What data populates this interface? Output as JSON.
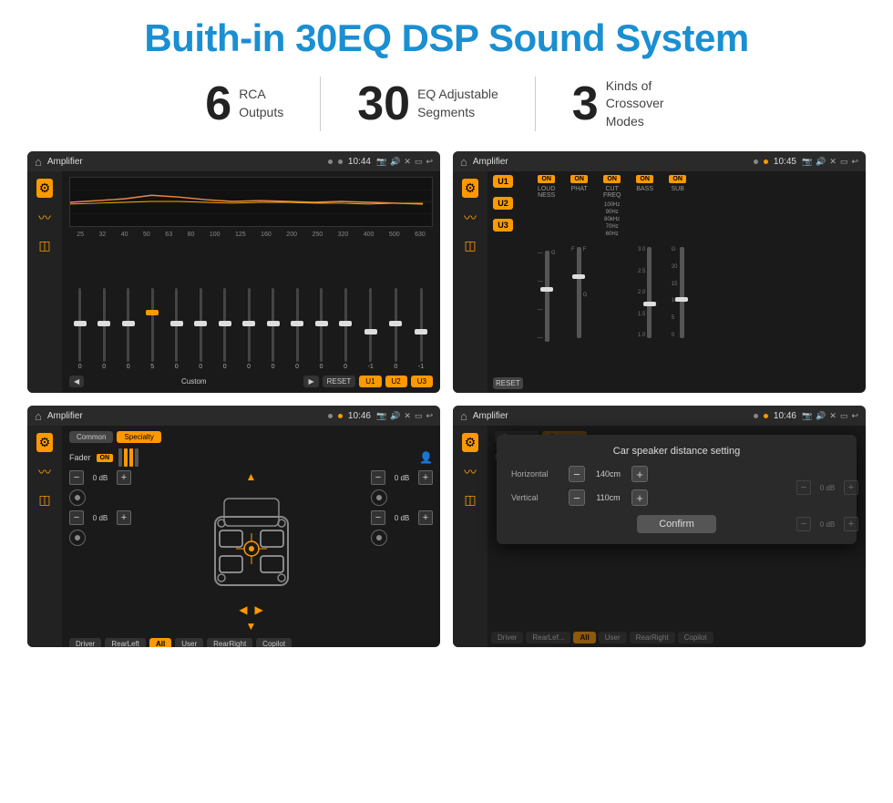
{
  "page": {
    "background": "#ffffff"
  },
  "header": {
    "title": "Buith-in 30EQ DSP Sound System"
  },
  "stats": {
    "item1": {
      "number": "6",
      "label": "RCA\nOutputs"
    },
    "item2": {
      "number": "30",
      "label": "EQ Adjustable\nSegments"
    },
    "item3": {
      "number": "3",
      "label": "Kinds of\nCrossover Modes"
    }
  },
  "screens": {
    "screen1": {
      "status_title": "Amplifier",
      "time": "10:44",
      "type": "eq",
      "freqs": [
        "25",
        "32",
        "40",
        "50",
        "63",
        "80",
        "100",
        "125",
        "160",
        "200",
        "250",
        "320",
        "400",
        "500",
        "630"
      ],
      "values": [
        "0",
        "0",
        "0",
        "5",
        "0",
        "0",
        "0",
        "0",
        "0",
        "0",
        "0",
        "0",
        "-1",
        "0",
        "-1"
      ],
      "mode_label": "Custom",
      "buttons": [
        "RESET",
        "U1",
        "U2",
        "U3"
      ]
    },
    "screen2": {
      "status_title": "Amplifier",
      "time": "10:45",
      "type": "mixer",
      "presets": [
        "U1",
        "U2",
        "U3"
      ],
      "channels": [
        {
          "toggle": "ON",
          "label": "LOUDNESS"
        },
        {
          "toggle": "ON",
          "label": "PHAT"
        },
        {
          "toggle": "ON",
          "label": "CUT FREQ"
        },
        {
          "toggle": "ON",
          "label": "BASS"
        },
        {
          "toggle": "ON",
          "label": "SUB"
        }
      ],
      "reset_label": "RESET"
    },
    "screen3": {
      "status_title": "Amplifier",
      "time": "10:46",
      "type": "fader",
      "tabs": [
        "Common",
        "Specialty"
      ],
      "fader_label": "Fader",
      "toggle_on": "ON",
      "db_values": [
        "0 dB",
        "0 dB",
        "0 dB",
        "0 dB"
      ],
      "bottom_buttons": [
        "Driver",
        "RearLeft",
        "All",
        "User",
        "RearRight",
        "Copilot"
      ]
    },
    "screen4": {
      "status_title": "Amplifier",
      "time": "10:46",
      "type": "distance_dialog",
      "tabs": [
        "Common",
        "Specialty"
      ],
      "dialog_title": "Car speaker distance setting",
      "horizontal_label": "Horizontal",
      "horizontal_value": "140cm",
      "vertical_label": "Vertical",
      "vertical_value": "110cm",
      "confirm_label": "Confirm",
      "bottom_buttons": [
        "Driver",
        "RearLeft",
        "All",
        "User",
        "RearRight",
        "Copilot"
      ],
      "db_values": [
        "0 dB",
        "0 dB"
      ]
    }
  }
}
